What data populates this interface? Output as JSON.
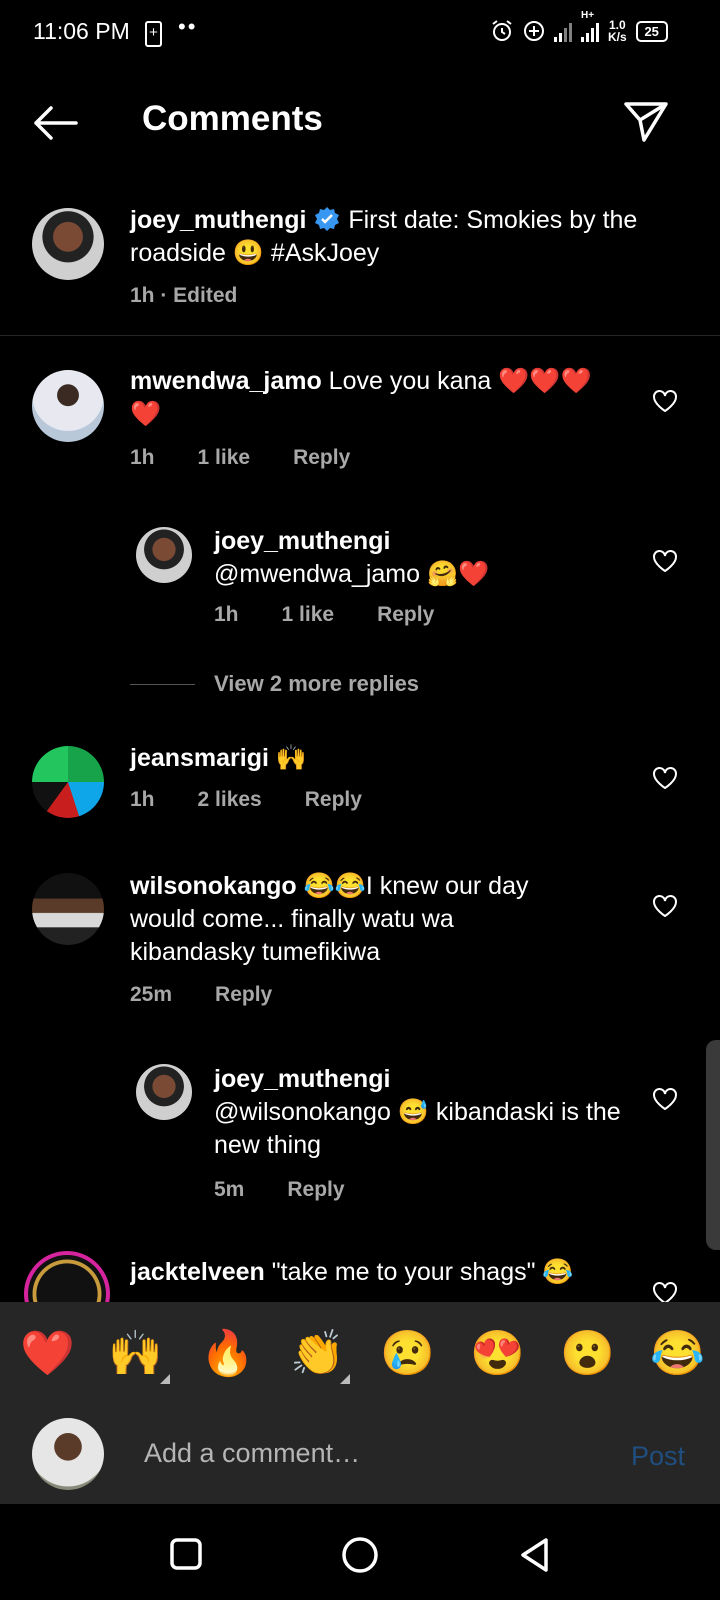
{
  "status_bar": {
    "time": "11:06 PM",
    "battery_small": "+",
    "dots": "••",
    "network_type": "H+",
    "speed_value": "1.0",
    "speed_unit": "K/s",
    "battery": "25"
  },
  "header": {
    "title": "Comments"
  },
  "caption": {
    "username": "joey_muthengi",
    "text": " First date: Smokies by the roadside 😃 #AskJoey",
    "meta": "1h · Edited"
  },
  "comments": [
    {
      "username": "mwendwa_jamo",
      "text": " Love you kana ❤️❤️❤️❤️",
      "time": "1h",
      "likes": "1 like",
      "reply": "Reply"
    },
    {
      "username": "joey_muthengi",
      "text": "@mwendwa_jamo 🤗❤️",
      "time": "1h",
      "likes": "1 like",
      "reply": "Reply"
    },
    {
      "username": "jeansmarigi",
      "text": " 🙌",
      "time": "1h",
      "likes": "2 likes",
      "reply": "Reply"
    },
    {
      "username": "wilsonokango",
      "text": " 😂😂I knew our day would come... finally watu wa kibandasky tumefikiwa",
      "time": "25m",
      "likes": "",
      "reply": "Reply"
    },
    {
      "username": "joey_muthengi",
      "text": "@wilsonokango 😅 kibandaski is the new thing",
      "time": "5m",
      "likes": "",
      "reply": "Reply"
    },
    {
      "username": "jacktelveen",
      "text": " \"take me to your shags\" 😂",
      "time": "",
      "likes": "",
      "reply": ""
    }
  ],
  "view_more": "View 2 more replies",
  "emoji_bar": [
    "❤️",
    "🙌",
    "🔥",
    "👏",
    "😢",
    "😍",
    "😮",
    "😂"
  ],
  "composer": {
    "placeholder": "Add a comment…",
    "post": "Post"
  },
  "colors": {
    "background": "#000000",
    "panel": "#262626",
    "verified": "#3897f0",
    "post_disabled": "#1f4f80"
  }
}
